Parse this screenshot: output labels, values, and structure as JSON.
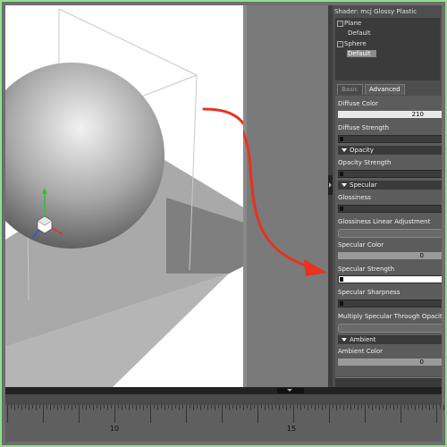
{
  "panel": {
    "title": "Shader: mcj Glossy Plastic",
    "tree": [
      {
        "label": "Plane",
        "type": "parent"
      },
      {
        "label": "Default",
        "type": "child"
      },
      {
        "label": "Sphere",
        "type": "parent"
      },
      {
        "label": "Default",
        "type": "child",
        "selected": true
      }
    ],
    "tabs": [
      "Basic",
      "Advanced"
    ],
    "active_tab": "Advanced",
    "properties": {
      "diffuse_color_label": "Diffuse Color",
      "diffuse_color_value": "210",
      "diffuse_strength_label": "Diffuse Strength",
      "opacity_section": "Opacity",
      "opacity_strength_label": "Opacity Strength",
      "specular_section": "Specular",
      "glossiness_label": "Glossiness",
      "glossiness_linear_label": "Glossiness Linear Adjustment",
      "specular_color_label": "Specular Color",
      "specular_color_value": "0",
      "specular_strength_label": "Specular Strength",
      "specular_sharpness_label": "Specular Sharpness",
      "multiply_specular_label": "Multiply Specular Through Opacity",
      "ambient_section": "Ambient",
      "ambient_color_label": "Ambient Color",
      "ambient_color_value": "0"
    }
  },
  "timeline": {
    "labels": [
      "10",
      "15"
    ]
  },
  "colors": {
    "annotation_arrow": "#e8321e",
    "frame": "#8fe08a",
    "gizmo_x": "#e03030",
    "gizmo_y": "#30c030",
    "gizmo_z": "#3050e0"
  },
  "icons": {
    "tree_expand": "boxed-minus-icon",
    "section_toggle": "triangle-down-icon",
    "timeline_toggle": "chevron-down-icon"
  }
}
